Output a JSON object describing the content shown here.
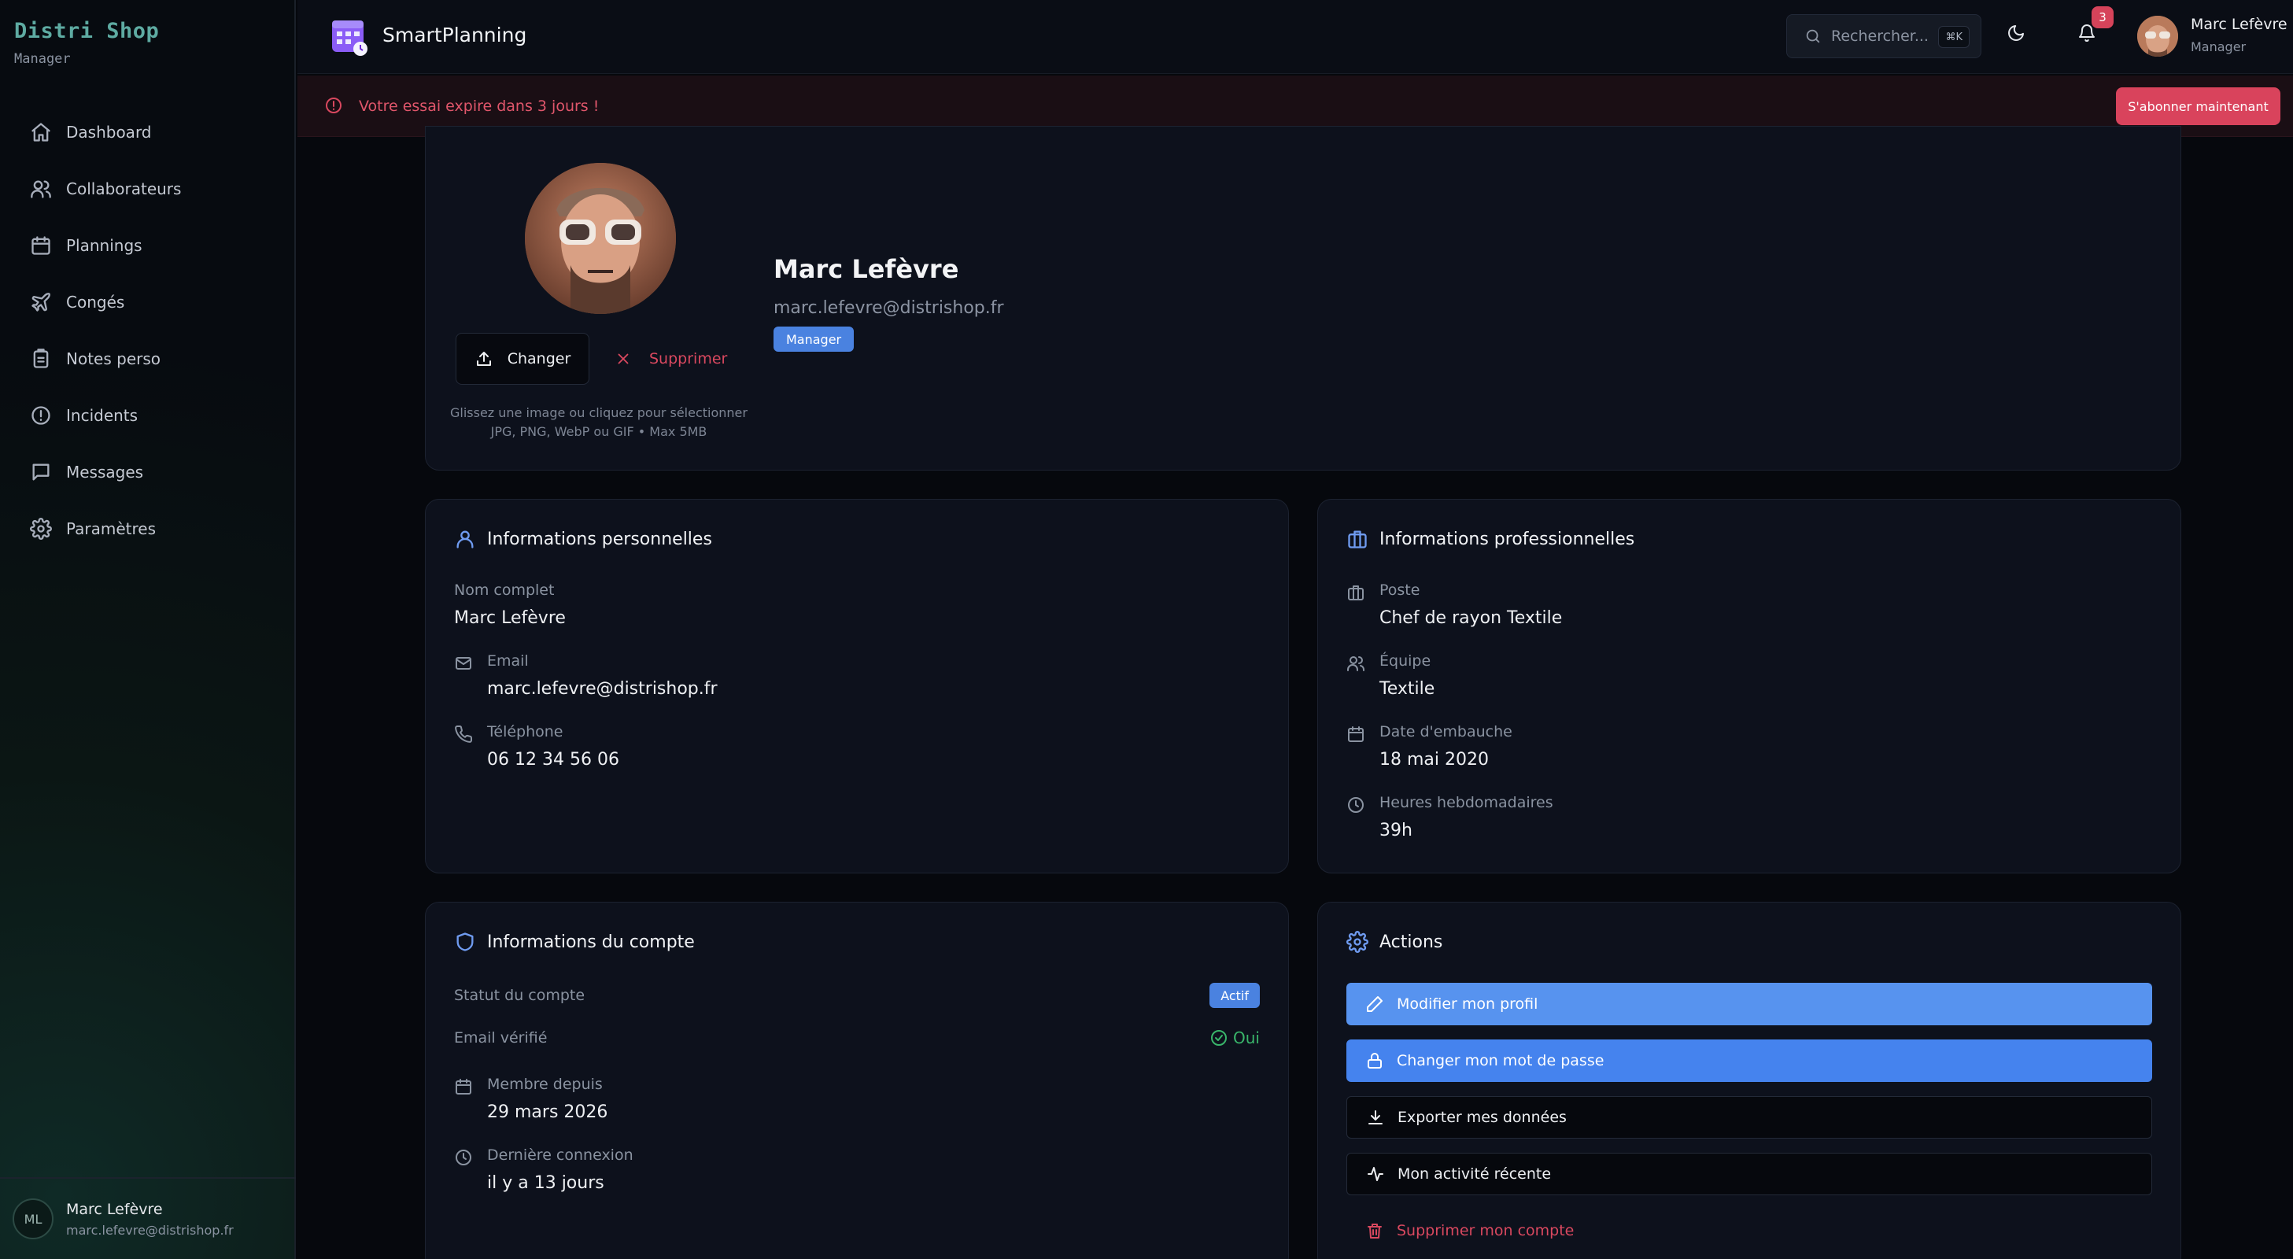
{
  "sidebar": {
    "brand": "Distri Shop",
    "brand_sub": "Manager",
    "items": [
      {
        "label": "Dashboard",
        "icon": "home-icon"
      },
      {
        "label": "Collaborateurs",
        "icon": "users-icon"
      },
      {
        "label": "Plannings",
        "icon": "calendar-icon"
      },
      {
        "label": "Congés",
        "icon": "plane-icon"
      },
      {
        "label": "Notes perso",
        "icon": "clipboard-icon"
      },
      {
        "label": "Incidents",
        "icon": "alert-circle-icon"
      },
      {
        "label": "Messages",
        "icon": "message-icon"
      },
      {
        "label": "Paramètres",
        "icon": "gear-icon"
      }
    ],
    "user": {
      "initials": "ML",
      "name": "Marc Lefèvre",
      "email": "marc.lefevre@distrishop.fr"
    }
  },
  "topbar": {
    "app_name": "SmartPlanning",
    "search_placeholder": "Rechercher...",
    "search_shortcut": "⌘K",
    "notification_count": "3",
    "user_name": "Marc Lefèvre",
    "user_role": "Manager"
  },
  "banner": {
    "text": "Votre essai expire dans 3 jours !",
    "button": "S'abonner maintenant"
  },
  "profile": {
    "name": "Marc Lefèvre",
    "email": "marc.lefevre@distrishop.fr",
    "role": "Manager",
    "change_button": "Changer",
    "delete_button": "Supprimer",
    "hint_line1": "Glissez une image ou cliquez pour sélectionner",
    "hint_line2": "JPG, PNG, WebP ou GIF • Max 5MB"
  },
  "personal": {
    "title": "Informations personnelles",
    "full_name_label": "Nom complet",
    "full_name": "Marc Lefèvre",
    "email_label": "Email",
    "email": "marc.lefevre@distrishop.fr",
    "phone_label": "Téléphone",
    "phone": "06 12 34 56 06"
  },
  "professional": {
    "title": "Informations professionnelles",
    "position_label": "Poste",
    "position": "Chef de rayon Textile",
    "team_label": "Équipe",
    "team": "Textile",
    "hire_label": "Date d'embauche",
    "hire_date": "18 mai 2020",
    "hours_label": "Heures hebdomadaires",
    "hours": "39h"
  },
  "account": {
    "title": "Informations du compte",
    "status_label": "Statut du compte",
    "status": "Actif",
    "verified_label": "Email vérifié",
    "verified": "Oui",
    "member_label": "Membre depuis",
    "member_since": "29 mars 2026",
    "last_login_label": "Dernière connexion",
    "last_login": "il y a 13 jours"
  },
  "actions": {
    "title": "Actions",
    "edit_profile": "Modifier mon profil",
    "change_password": "Changer mon mot de passe",
    "export_data": "Exporter mes données",
    "recent_activity": "Mon activité récente",
    "delete_account": "Supprimer mon compte"
  },
  "colors": {
    "accent": "#5793ef",
    "danger": "#d9435c",
    "brand": "#5eaba2",
    "success": "#39b56a"
  }
}
